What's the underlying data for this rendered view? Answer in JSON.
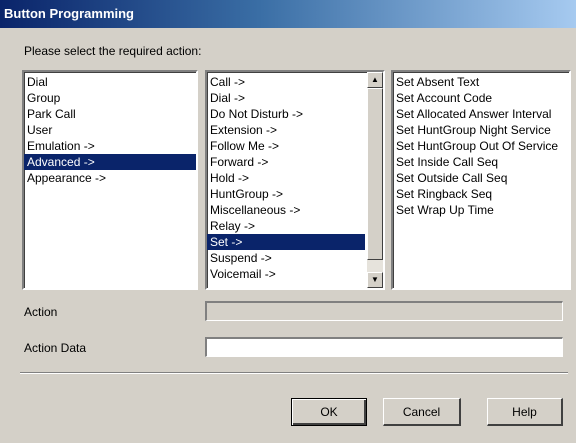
{
  "window": {
    "title": "Button Programming"
  },
  "prompt": "Please select the required action:",
  "actions": {
    "items": [
      "Dial",
      "Group",
      "Park Call",
      "User",
      "Emulation ->",
      "Advanced ->",
      "Appearance ->"
    ],
    "selected": "Advanced ->"
  },
  "advanced": {
    "items": [
      "Call ->",
      "Dial ->",
      "Do Not Disturb ->",
      "Extension ->",
      "Follow Me ->",
      "Forward ->",
      "Hold ->",
      "HuntGroup ->",
      "Miscellaneous ->",
      "Relay ->",
      "Set ->",
      "Suspend ->",
      "Voicemail ->"
    ],
    "selected": "Set ->"
  },
  "set_options": {
    "items": [
      "Set Absent Text",
      "Set Account Code",
      "Set Allocated Answer Interval",
      "Set HuntGroup Night Service",
      "Set HuntGroup Out Of Service",
      "Set Inside Call Seq",
      "Set Outside Call Seq",
      "Set Ringback Seq",
      "Set Wrap Up Time"
    ]
  },
  "form": {
    "action_label": "Action",
    "action_value": "",
    "action_data_label": "Action Data",
    "action_data_value": ""
  },
  "buttons": {
    "ok": "OK",
    "cancel": "Cancel",
    "help": "Help"
  },
  "colors": {
    "title_start": "#0a246a",
    "title_end": "#a6caf0",
    "selection": "#0a246a",
    "dialog_bg": "#d4d0c8"
  },
  "icons": {
    "scroll_up": "up-arrow-icon",
    "scroll_down": "down-arrow-icon"
  }
}
